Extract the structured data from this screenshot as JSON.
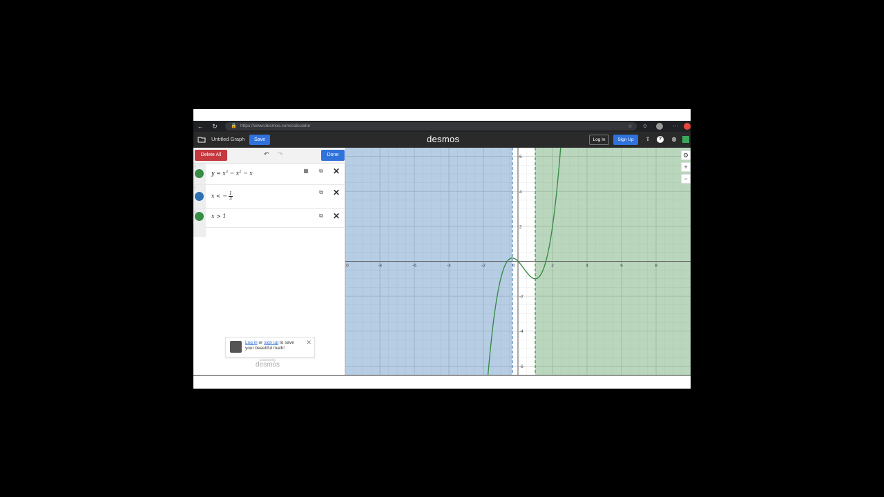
{
  "browser": {
    "url": "https://www.desmos.com/calculator",
    "back_icon": "back-arrow-icon",
    "reload_icon": "reload-icon"
  },
  "header": {
    "graph_title": "Untitled Graph",
    "save_label": "Save",
    "brand": "desmos",
    "login_label": "Log In",
    "signup_label": "Sign Up"
  },
  "toolbar": {
    "delete_all_label": "Delete All",
    "done_label": "Done"
  },
  "expressions": [
    {
      "index": "1",
      "color": "#388c46",
      "lhs": "y = x",
      "p1": "3",
      "mid": " − x",
      "p2": "2",
      "rhs": " − x"
    },
    {
      "index": "2",
      "color": "#2d70b3",
      "text": "x < −",
      "num": "1",
      "den": "3"
    },
    {
      "index": "3",
      "color": "#388c46",
      "text": "x > 1"
    }
  ],
  "save_prompt": {
    "login_text": "Log in",
    "or_text": " or ",
    "signup_text": "sign up",
    "rest_text": " to save your beautiful math!"
  },
  "powered_by": {
    "small": "powered by",
    "big": "desmos"
  },
  "graph": {
    "x_range": [
      -10,
      10
    ],
    "y_range": [
      -6.5,
      6.5
    ],
    "x_ticks": [
      "-10",
      "-8",
      "-6",
      "-4",
      "-2",
      "0",
      "2",
      "4",
      "6",
      "8"
    ],
    "y_ticks": [
      "6",
      "4",
      "2",
      "-2",
      "-4",
      "-6"
    ],
    "region_left_color": "#2d70b3",
    "region_right_color": "#388c46",
    "curve_color": "#388c46"
  }
}
